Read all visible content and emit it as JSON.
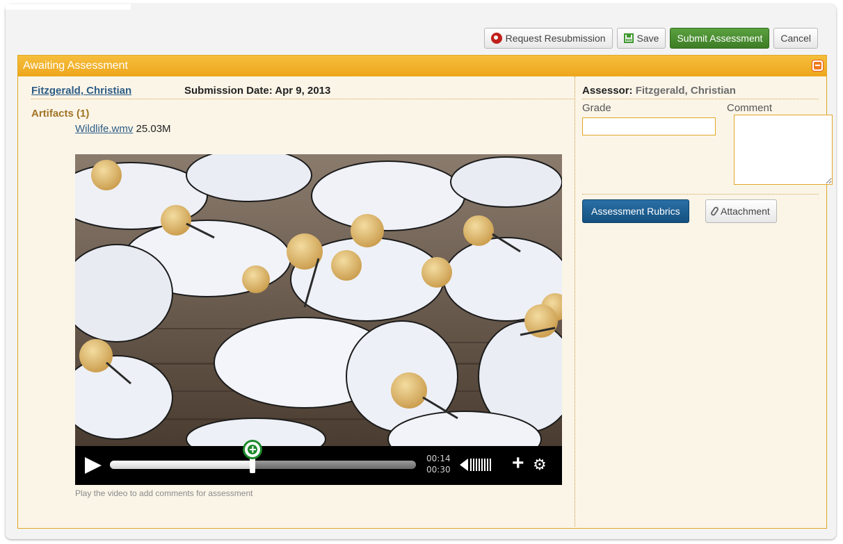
{
  "toolbar": {
    "request_resubmission": "Request Resubmission",
    "save": "Save",
    "submit_assessment": "Submit Assessment",
    "cancel": "Cancel"
  },
  "panel": {
    "title": "Awaiting Assessment",
    "student_name": "Fitzgerald, Christian",
    "submission_date": "Submission Date: Apr 9, 2013",
    "artifacts_label": "Artifacts (1)",
    "file_name": "Wildlife.wmv",
    "file_size": "25.03M",
    "hint": "Play the video to add comments for assessment"
  },
  "player": {
    "current_time": "00:14",
    "total_time": "00:30",
    "progress": 0.4667
  },
  "assessment": {
    "assessor_label": "Assessor:",
    "assessor_name": "Fitzgerald, Christian",
    "grade_label": "Grade",
    "comment_label": "Comment",
    "grade_value": "",
    "comment_value": "",
    "rubrics_button": "Assessment Rubrics",
    "attachment_button": "Attachment"
  },
  "colors": {
    "panel_header": "#eda61c",
    "submit_green": "#3d7d26",
    "rubrics_blue": "#14517f",
    "link_blue": "#2c5c85"
  },
  "icons": {
    "resubmit": "undo-icon",
    "save": "floppy-disk-icon",
    "collapse": "minus-icon",
    "play": "play-icon",
    "add_comment": "plus-circle-icon",
    "volume": "speaker-icon",
    "zoom": "plus-icon",
    "settings": "gear-icon",
    "attachment": "paperclip-icon"
  }
}
